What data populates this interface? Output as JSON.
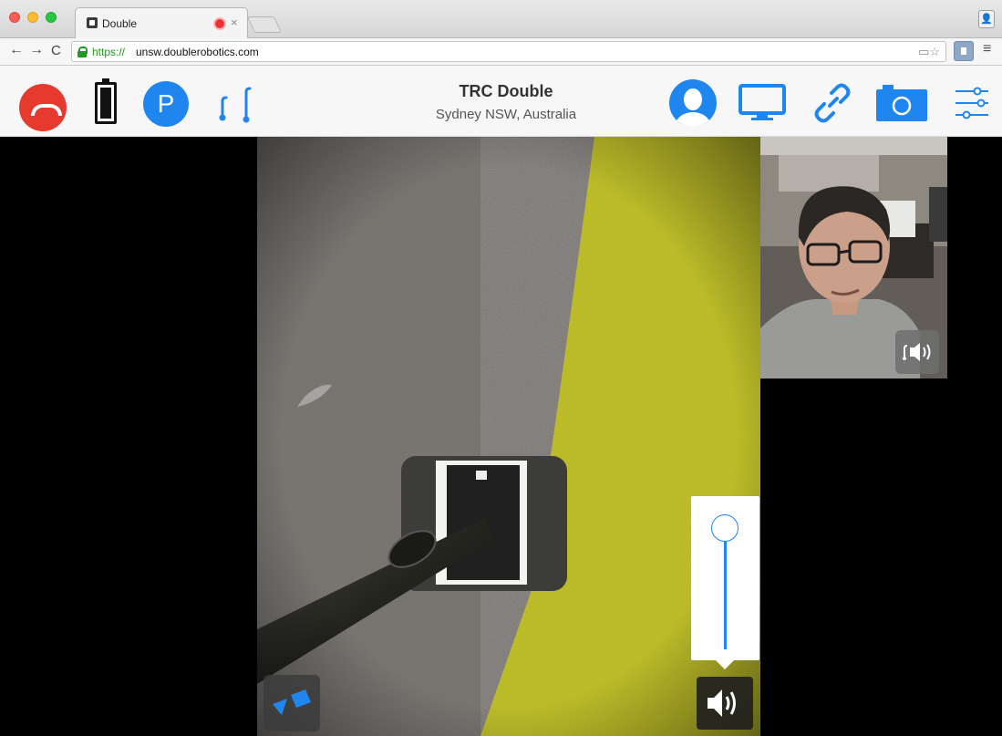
{
  "browser": {
    "tab_title": "Double",
    "tab_close": "×",
    "url_scheme": "https://",
    "url_host": "unsw.doublerobotics.com",
    "nav_back": "←",
    "nav_forward": "→",
    "nav_reload": "C",
    "omni_icons": "▭☆",
    "menu": "≡",
    "profile": "👤"
  },
  "robot": {
    "name": "TRC Double",
    "location": "Sydney NSW, Australia",
    "park_label": "P"
  },
  "colors": {
    "accent": "#1f86f0",
    "hangup": "#e63a2e",
    "carpet_grey": "#7d7975",
    "carpet_yellow": "#c3c32b"
  },
  "icons": {
    "hangup": "hangup-icon",
    "battery": "battery-icon",
    "park": "park-icon",
    "pole": "pole-height-icon",
    "user": "user-icon",
    "monitor": "screen-share-icon",
    "link": "link-icon",
    "camera": "camera-icon",
    "settings": "sliders-icon",
    "volume": "speaker-icon",
    "map": "navigation-icon"
  },
  "volume": {
    "level_fraction": 1.0
  }
}
